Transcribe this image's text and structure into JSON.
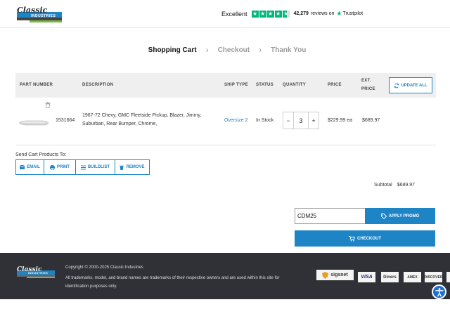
{
  "header": {
    "logo_text": "Classic Industries",
    "trustpilot": {
      "rating_word": "Excellent",
      "reviews_count": "42,279",
      "reviews_word": "reviews on",
      "brand": "Trustpilot"
    }
  },
  "steps": [
    {
      "label": "Shopping Cart",
      "active": true
    },
    {
      "label": "Checkout",
      "active": false
    },
    {
      "label": "Thank You",
      "active": false
    }
  ],
  "table": {
    "headers": {
      "part_number": "PART NUMBER",
      "description": "DESCRIPTION",
      "ship_type": "SHIP TYPE",
      "status": "STATUS",
      "quantity": "QUANTITY",
      "price": "PRICE",
      "ext_price_line1": "EXT.",
      "ext_price_line2": "PRICE"
    },
    "update_all_label": "UPDATE ALL",
    "rows": [
      {
        "part_number": "1531664",
        "description": "1967-72 Chevy, GMC Fleetside Pickup, Blazer, Jimmy, Suburban, Rear Bumper, Chrome,",
        "ship_type": "Oversize 2",
        "status": "In Stock",
        "quantity": "3",
        "price": "$229.99 ea",
        "ext_price": "$689.97"
      }
    ]
  },
  "send_cart": {
    "label": "Send Cart Products To:",
    "buttons": {
      "email": "EMAIL",
      "print": "PRINT",
      "buildlist": "BUILDLIST",
      "remove": "REMOVE"
    }
  },
  "summary": {
    "subtotal_label": "Subtotal",
    "subtotal_value": "$689.97",
    "promo_value": "CDM25",
    "apply_promo_label": "APPLY PROMO",
    "checkout_label": "CHECKOUT"
  },
  "footer": {
    "copyright": "Copyright © 2000-2025 Classic Industries",
    "note": "All trademarks, model, and brand names are trademarks of their respective owners and are used within this site for identification purposes only.",
    "badges": {
      "sigsnet": "sigsnet",
      "visa": "VISA",
      "diners": "Diners",
      "amex": "AMEX",
      "discover": "DISCOVER"
    }
  },
  "colors": {
    "accent": "#1d84c6",
    "trustpilot_green": "#00b67a",
    "footer_bg": "#2f3136",
    "table_header_bg": "#efefef"
  }
}
